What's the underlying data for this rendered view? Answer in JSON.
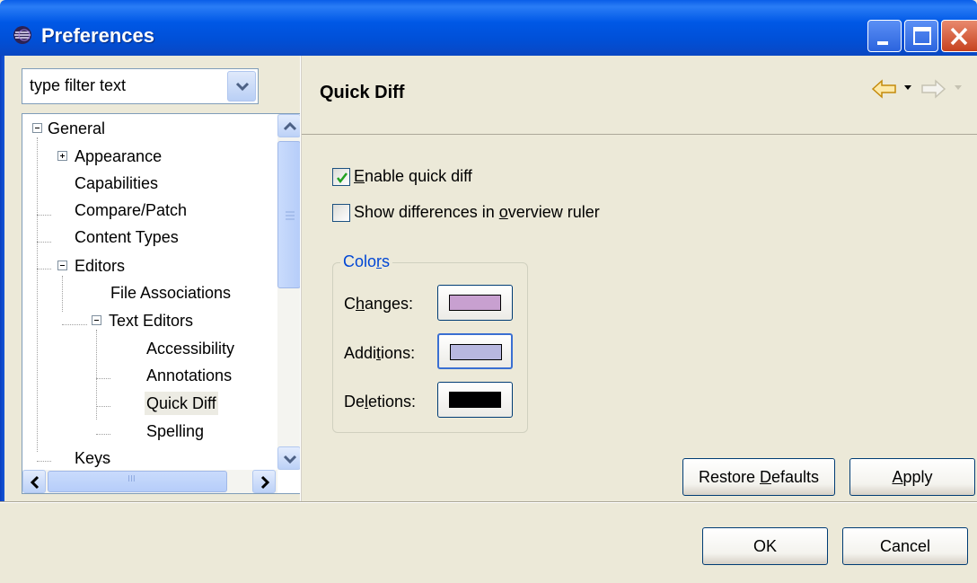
{
  "window": {
    "title": "Preferences",
    "accent": "#0058e6"
  },
  "filter": {
    "value": "type filter text"
  },
  "tree": {
    "items": [
      {
        "label": "General",
        "expander": "minus"
      },
      {
        "label": "Appearance",
        "expander": "plus"
      },
      {
        "label": "Capabilities"
      },
      {
        "label": "Compare/Patch"
      },
      {
        "label": "Content Types"
      },
      {
        "label": "Editors",
        "expander": "minus"
      },
      {
        "label": "File Associations"
      },
      {
        "label": "Text Editors",
        "expander": "minus"
      },
      {
        "label": "Accessibility"
      },
      {
        "label": "Annotations"
      },
      {
        "label": "Quick Diff",
        "selected": true
      },
      {
        "label": "Spelling"
      },
      {
        "label": "Keys"
      }
    ],
    "scroll_thumb_text": "III"
  },
  "page": {
    "title": "Quick Diff"
  },
  "options": {
    "enable_quick_diff": {
      "label_pre": "",
      "mnemonic": "E",
      "label_post": "nable quick diff",
      "checked": true
    },
    "show_differences": {
      "label_pre": "Show differences in ",
      "mnemonic": "o",
      "label_post": "verview ruler",
      "checked": false
    }
  },
  "colors_group": {
    "legend_pre": "Colo",
    "legend_mnemonic": "r",
    "legend_post": "s",
    "rows": [
      {
        "label_pre": "C",
        "mnemonic": "h",
        "label_post": "anges:",
        "swatch": "#c8a0d0"
      },
      {
        "label_pre": "Addi",
        "mnemonic": "t",
        "label_post": "ions:",
        "swatch": "#b8b8e0"
      },
      {
        "label_pre": "De",
        "mnemonic": "l",
        "label_post": "etions:",
        "swatch": "#000000"
      }
    ]
  },
  "buttons": {
    "restore_pre": "Restore ",
    "restore_mnemonic": "D",
    "restore_post": "efaults",
    "apply_mnemonic": "A",
    "apply_post": "pply",
    "ok": "OK",
    "cancel": "Cancel"
  }
}
